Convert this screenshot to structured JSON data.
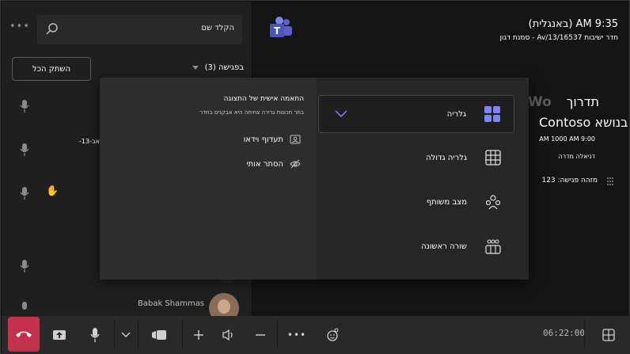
{
  "left_panel": {
    "search_placeholder": "הקלד שם",
    "mute_all_label": "השתק הכל",
    "in_meeting_label": "בפגישה (3)",
    "partial_date_text": "-13-אב/",
    "participant_name": "Babak Shammas"
  },
  "meeting": {
    "time_label": "9:35 AM (באנגלית)",
    "room_label": "חדר ישיבות Av/13/16537 - סמנת דגון",
    "partial_banner_text": "Wo",
    "title_line": "תדרוך",
    "contoso_line": "בנושא Contoso",
    "contoso_time": "9:00 AM 1000 AM",
    "organizer": "דניאלה מדרה",
    "meeting_id": "מזהה פגישה: 123"
  },
  "popup": {
    "custom_title": "התאמה אישית של התצוגה",
    "custom_subtitle": "בחר תכונות גרירה צחיחה היא אבקנים בחדר",
    "options": [
      {
        "label": "תעדוף וידאו",
        "icon": "video-priority-icon"
      },
      {
        "label": "הסתר אותי",
        "icon": "eye-off-icon"
      }
    ],
    "views": [
      {
        "label": "גלריה",
        "icon": "gallery-icon",
        "selected": true
      },
      {
        "label": "גלריה גדולה",
        "icon": "large-gallery-icon",
        "selected": false
      },
      {
        "label": "מצב משותף",
        "icon": "together-mode-icon",
        "selected": false
      },
      {
        "label": "שורה ראשונה",
        "icon": "front-row-icon",
        "selected": false
      }
    ]
  },
  "toolbar": {
    "timer": "06:22:00",
    "buttons": [
      "hang-up",
      "share",
      "mic",
      "camera-options",
      "camera",
      "add",
      "volume",
      "minus",
      "more",
      "reactions",
      "layout"
    ]
  },
  "colors": {
    "hangup": "#c4314b",
    "accent": "#7f85f5",
    "teams_purple": "#5b5fc7"
  }
}
